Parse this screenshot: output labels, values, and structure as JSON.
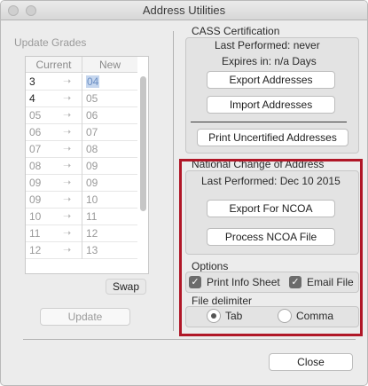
{
  "window": {
    "title": "Address Utilities"
  },
  "grades": {
    "heading": "Update Grades",
    "columns": [
      "Current",
      "New"
    ],
    "rows": [
      {
        "current": "3",
        "new": "04"
      },
      {
        "current": "4",
        "new": "05"
      },
      {
        "current": "05",
        "new": "06"
      },
      {
        "current": "06",
        "new": "07"
      },
      {
        "current": "07",
        "new": "08"
      },
      {
        "current": "08",
        "new": "09"
      },
      {
        "current": "09",
        "new": "09"
      },
      {
        "current": "09",
        "new": "10"
      },
      {
        "current": "10",
        "new": "11"
      },
      {
        "current": "11",
        "new": "12"
      },
      {
        "current": "12",
        "new": "13"
      }
    ],
    "row_arrow_icon": "arrow-right-icon",
    "swap_label": "Swap",
    "update_label": "Update"
  },
  "cass": {
    "heading": "CASS Certification",
    "last_performed": "Last Performed: never",
    "expires": "Expires in: n/a Days",
    "export_label": "Export Addresses",
    "import_label": "Import Addresses",
    "print_uncertified_label": "Print Uncertified Addresses"
  },
  "ncoa": {
    "heading": "National Change of Address",
    "last_performed": "Last Performed: Dec 10 2015",
    "export_label": "Export For NCOA",
    "process_label": "Process NCOA File",
    "highlight_color": "#b01727"
  },
  "options": {
    "heading": "Options",
    "print_info_sheet": {
      "label": "Print Info Sheet",
      "checked": true
    },
    "email_file": {
      "label": "Email File",
      "checked": true
    }
  },
  "delimiter": {
    "heading": "File delimiter",
    "tab": {
      "label": "Tab",
      "selected": true
    },
    "comma": {
      "label": "Comma",
      "selected": false
    }
  },
  "footer": {
    "close_label": "Close"
  }
}
